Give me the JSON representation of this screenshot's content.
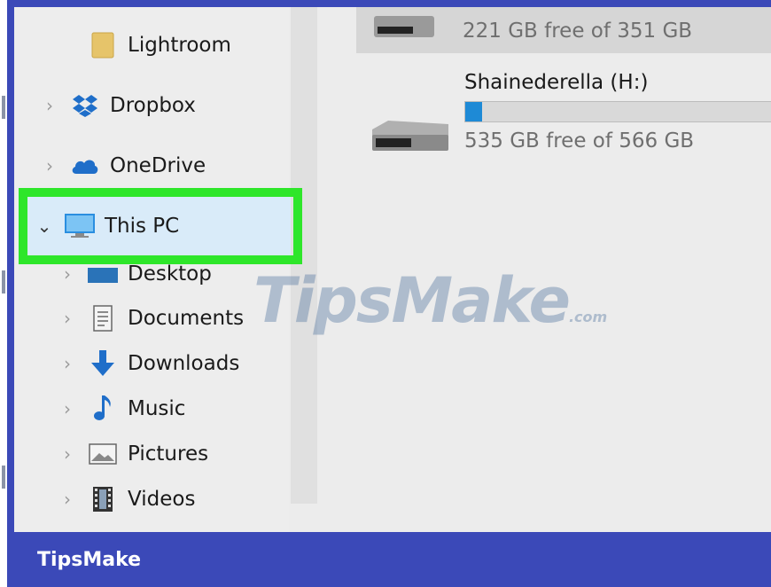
{
  "nav": {
    "items": [
      {
        "label": "Lightroom",
        "icon": "folder-icon",
        "color": "#dcb85a"
      },
      {
        "label": "Dropbox",
        "icon": "dropbox-icon",
        "color": "#1f6ec9"
      },
      {
        "label": "OneDrive",
        "icon": "onedrive-icon",
        "color": "#1f6ec9"
      },
      {
        "label": "This PC",
        "icon": "computer-icon",
        "color": "#2a8ee0"
      },
      {
        "label": "Desktop",
        "icon": "desktop-folder-icon",
        "color": "#2a73b8"
      },
      {
        "label": "Documents",
        "icon": "documents-icon",
        "color": "#666666"
      },
      {
        "label": "Downloads",
        "icon": "download-arrow-icon",
        "color": "#1f6ec9"
      },
      {
        "label": "Music",
        "icon": "music-note-icon",
        "color": "#1f6ec9"
      },
      {
        "label": "Pictures",
        "icon": "pictures-icon",
        "color": "#666666"
      },
      {
        "label": "Videos",
        "icon": "videos-icon",
        "color": "#333333"
      }
    ]
  },
  "drives": {
    "top_free": "221 GB free of 351 GB",
    "second_name": "Shainederella (H:)",
    "second_free": "535 GB free of 566 GB",
    "second_used_fraction": 0.055
  },
  "watermark": {
    "main": "TipsMake",
    "suffix": ".com"
  },
  "footer": {
    "brand": "TipsMake"
  },
  "colors": {
    "highlight": "#2ee62a",
    "brand_blue": "#3b49b8",
    "progress": "#1e8ad6"
  }
}
